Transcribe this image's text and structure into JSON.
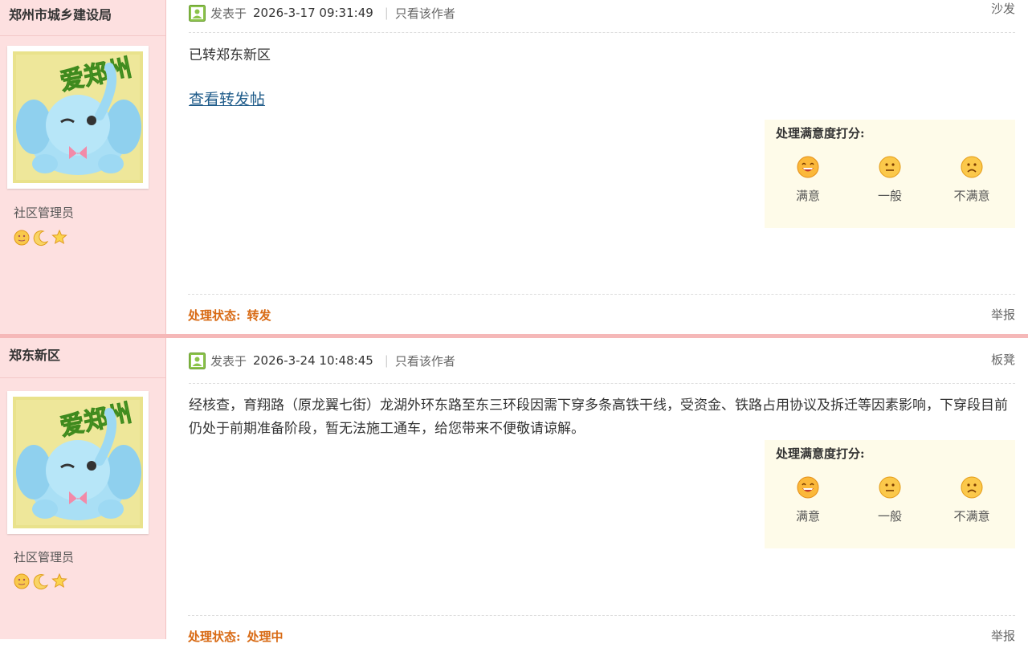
{
  "posts": [
    {
      "author": "郑州市城乡建设局",
      "role": "社区管理员",
      "posted_label": "发表于",
      "date": "2026-3-17 09:31:49",
      "only_author": "只看该作者",
      "floor": "沙发",
      "content": "已转郑东新区",
      "link": "查看转发帖",
      "rating_title": "处理满意度打分:",
      "ratings": [
        "满意",
        "一般",
        "不满意"
      ],
      "status_label": "处理状态:",
      "status_value": "转发",
      "report": "举报"
    },
    {
      "author": "郑东新区",
      "role": "社区管理员",
      "posted_label": "发表于",
      "date": "2026-3-24 10:48:45",
      "only_author": "只看该作者",
      "floor": "板凳",
      "content": "经核查，育翔路（原龙翼七街）龙湖外环东路至东三环段因需下穿多条高铁干线，受资金、铁路占用协议及拆迁等因素影响，下穿段目前仍处于前期准备阶段，暂无法施工通车，给您带来不便敬请谅解。",
      "rating_title": "处理满意度打分:",
      "ratings": [
        "满意",
        "一般",
        "不满意"
      ],
      "status_label": "处理状态:",
      "status_value": "处理中",
      "report": "举报"
    }
  ],
  "avatar_text": "爱郑州",
  "colors": {
    "sidebar_bg": "#fde0e0",
    "divider": "#f5b8b8",
    "status": "#d86a14",
    "link": "#215d8b",
    "rating_bg": "#fefbe9"
  }
}
